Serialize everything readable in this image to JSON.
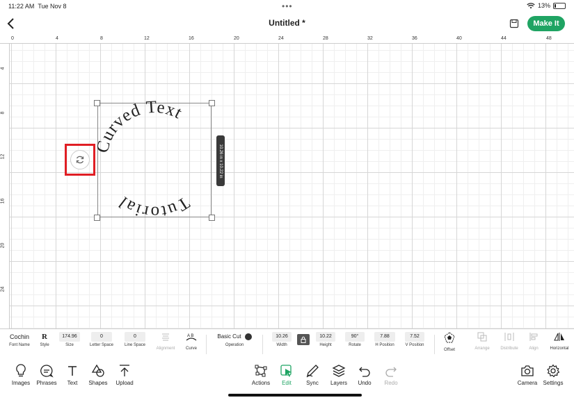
{
  "status": {
    "time": "11:22 AM",
    "date": "Tue Nov 8",
    "battery": "13%"
  },
  "header": {
    "title": "Untitled *",
    "make_it": "Make It"
  },
  "ruler": {
    "top": [
      "0",
      "4",
      "8",
      "12",
      "16",
      "20",
      "24",
      "28",
      "32",
      "36",
      "40",
      "44",
      "48"
    ],
    "left": [
      "4",
      "8",
      "12",
      "16",
      "20",
      "24"
    ]
  },
  "canvas": {
    "text_top": "Curved Text",
    "text_bottom": "Tutorial",
    "dimensions": "10.26 in x 10.22 in"
  },
  "toolbar": {
    "font_name": {
      "value": "Cochin",
      "label": "Font Name"
    },
    "style": {
      "value": "R",
      "label": "Style"
    },
    "size": {
      "value": "174.96",
      "label": "Size"
    },
    "letter_space": {
      "value": "0",
      "label": "Letter Space"
    },
    "line_space": {
      "value": "0",
      "label": "Line Space"
    },
    "alignment": {
      "label": "Alignment"
    },
    "curve": {
      "label": "Curve"
    },
    "operation": {
      "value": "Basic Cut",
      "label": "Operation"
    },
    "width": {
      "value": "10.26",
      "label": "Width"
    },
    "height": {
      "value": "10.22",
      "label": "Height"
    },
    "rotate": {
      "value": "90°",
      "label": "Rotate"
    },
    "h_position": {
      "value": "7.88",
      "label": "H Position"
    },
    "v_position": {
      "value": "7.52",
      "label": "V Position"
    },
    "offset": {
      "label": "Offset"
    },
    "arrange": {
      "label": "Arrange"
    },
    "distribute": {
      "label": "Distribute"
    },
    "align": {
      "label": "Align"
    },
    "horizontal": {
      "label": "Horizontal"
    }
  },
  "bottombar": {
    "images": "Images",
    "phrases": "Phrases",
    "text": "Text",
    "shapes": "Shapes",
    "upload": "Upload",
    "actions": "Actions",
    "edit": "Edit",
    "sync": "Sync",
    "layers": "Layers",
    "undo": "Undo",
    "redo": "Redo",
    "camera": "Camera",
    "settings": "Settings"
  },
  "colors": {
    "accent": "#1fa463",
    "highlight": "#e01e24"
  }
}
